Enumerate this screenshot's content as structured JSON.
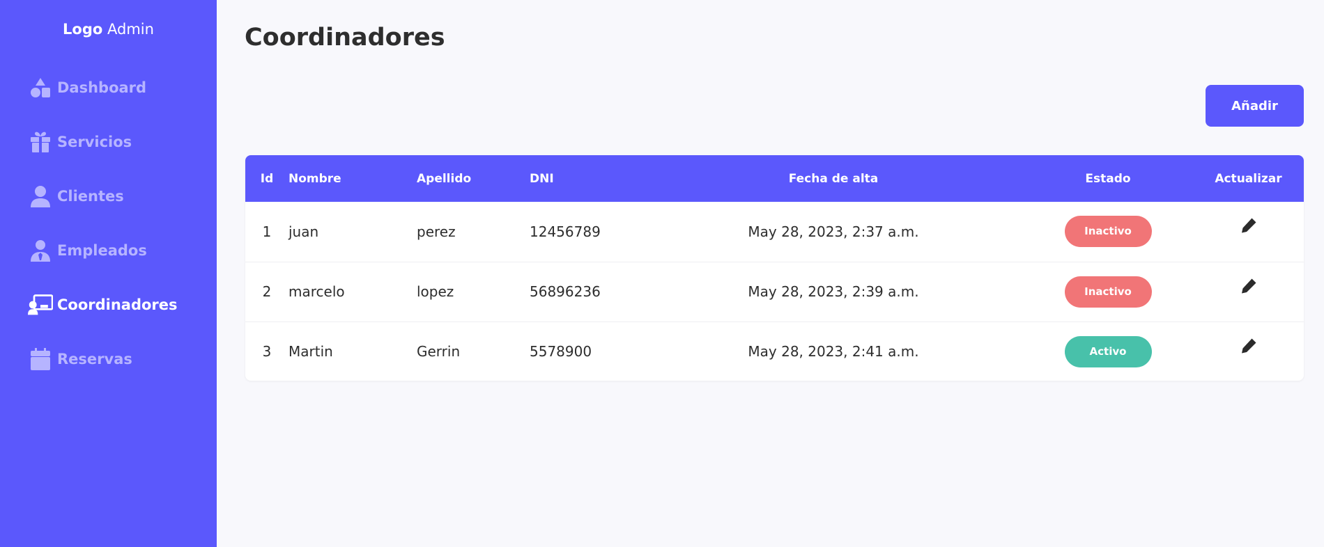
{
  "brand": {
    "strong": "Logo",
    "rest": "Admin"
  },
  "sidebar": {
    "items": [
      {
        "label": "Dashboard",
        "icon": "shapes-icon",
        "active": false
      },
      {
        "label": "Servicios",
        "icon": "gift-icon",
        "active": false
      },
      {
        "label": "Clientes",
        "icon": "user-icon",
        "active": false
      },
      {
        "label": "Empleados",
        "icon": "user-tie-icon",
        "active": false
      },
      {
        "label": "Coordinadores",
        "icon": "chalkboard-user-icon",
        "active": true
      },
      {
        "label": "Reservas",
        "icon": "calendar-icon",
        "active": false
      }
    ]
  },
  "main": {
    "title": "Coordinadores",
    "add_button": "Añadir"
  },
  "table": {
    "headers": {
      "id": "Id",
      "nombre": "Nombre",
      "apellido": "Apellido",
      "dni": "DNI",
      "fecha": "Fecha de alta",
      "estado": "Estado",
      "actualizar": "Actualizar"
    },
    "rows": [
      {
        "id": "1",
        "nombre": "juan",
        "apellido": "perez",
        "dni": "12456789",
        "fecha": "May 28, 2023, 2:37 a.m.",
        "estado": "Inactivo",
        "estado_color": "#f17577"
      },
      {
        "id": "2",
        "nombre": "marcelo",
        "apellido": "lopez",
        "dni": "56896236",
        "fecha": "May 28, 2023, 2:39 a.m.",
        "estado": "Inactivo",
        "estado_color": "#f17577"
      },
      {
        "id": "3",
        "nombre": "Martin",
        "apellido": "Gerrin",
        "dni": "5578900",
        "fecha": "May 28, 2023, 2:41 a.m.",
        "estado": "Activo",
        "estado_color": "#48c1aa"
      }
    ]
  },
  "colors": {
    "accent": "#5b58fc",
    "sidebar_inactive_text": "#b6b4ff",
    "inactive_badge": "#f17577",
    "active_badge": "#48c1aa"
  }
}
